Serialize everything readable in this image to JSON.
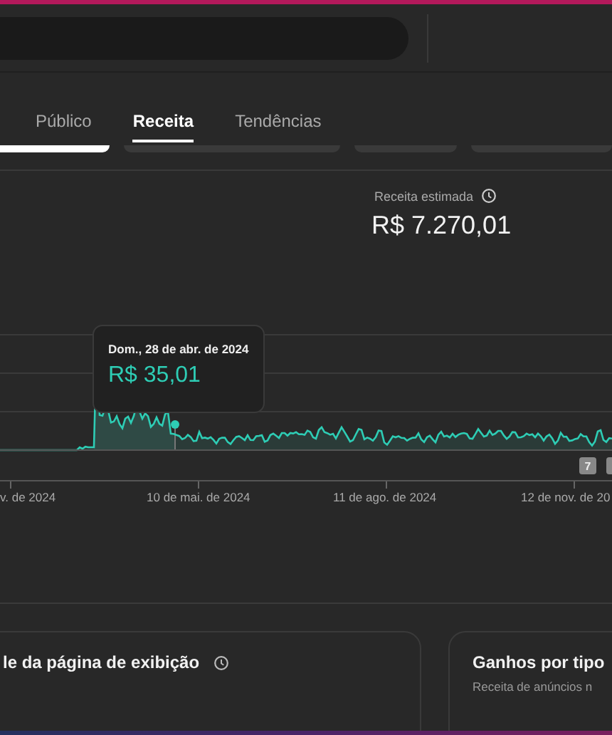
{
  "tabs": [
    {
      "label": "Público",
      "selected": false
    },
    {
      "label": "Receita",
      "selected": true
    },
    {
      "label": "Tendências",
      "selected": false
    }
  ],
  "summary": {
    "label": "Receita estimada",
    "value": "R$ 7.270,01"
  },
  "chart": {
    "tooltip": {
      "date": "Dom., 28 de abr. de 2024",
      "value": "R$ 35,01"
    },
    "x_labels": [
      "v. de 2024",
      "10 de mai. de 2024",
      "11 de ago. de 2024",
      "12 de nov. de 20"
    ],
    "markers": [
      "7"
    ]
  },
  "cards": [
    {
      "title": "le da página de exibição",
      "info": true
    },
    {
      "title": "Ganhos por tipo",
      "subtitle": "Receita de anúncios n",
      "info": false
    }
  ]
}
